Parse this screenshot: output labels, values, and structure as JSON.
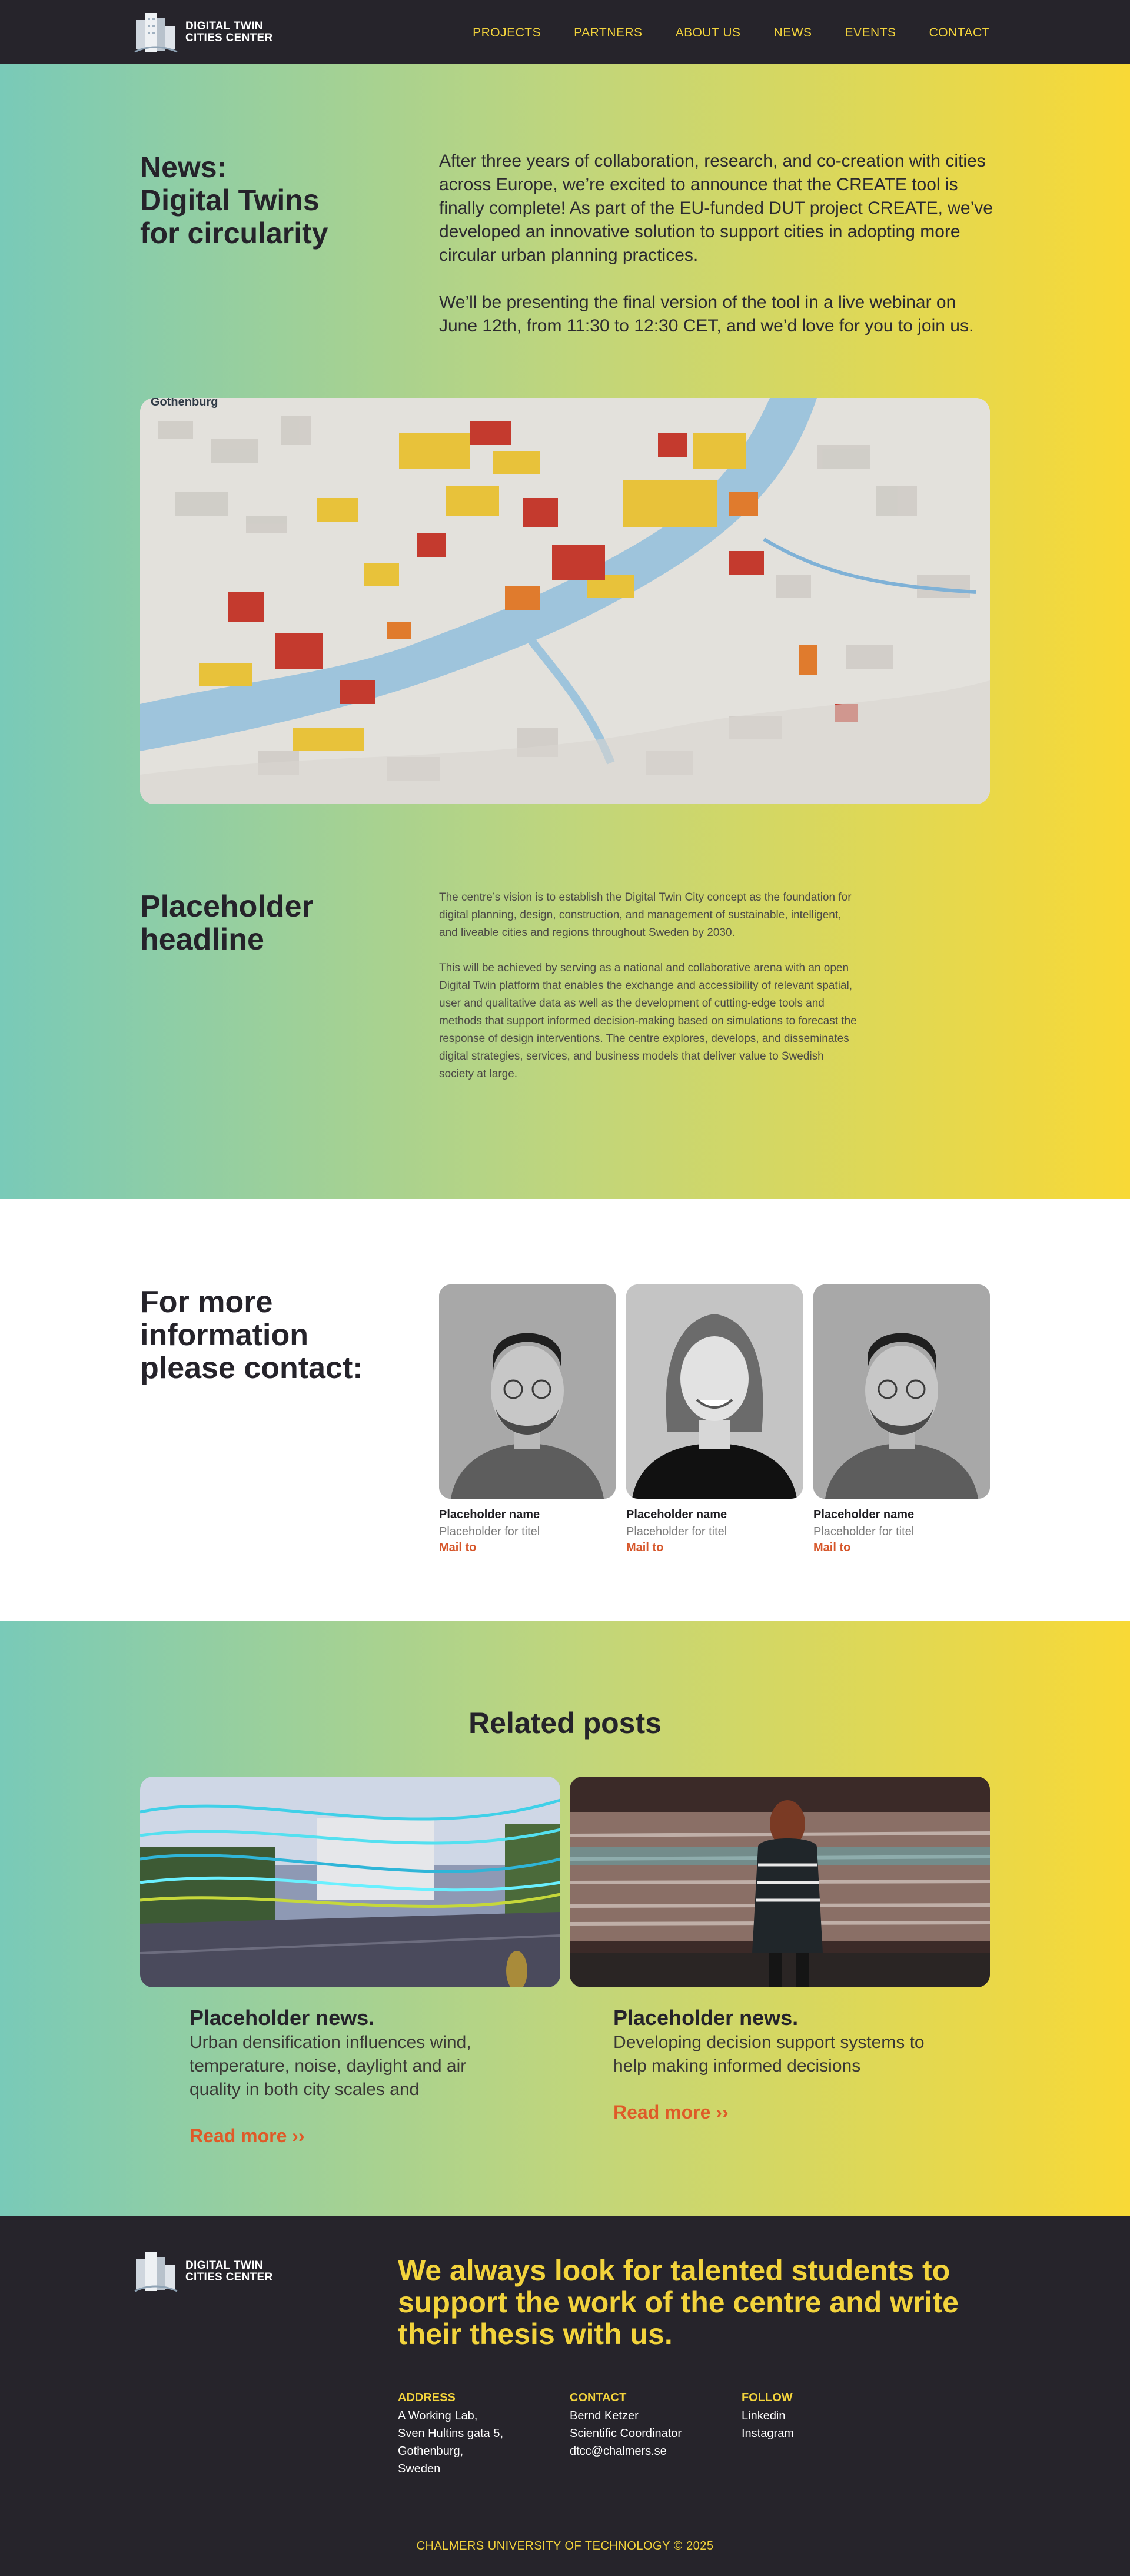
{
  "brand": {
    "name_line1": "DIGITAL TWIN",
    "name_line2": "CITIES CENTER"
  },
  "nav": {
    "items": [
      "PROJECTS",
      "PARTNERS",
      "ABOUT US",
      "NEWS",
      "EVENTS",
      "CONTACT"
    ]
  },
  "hero": {
    "title": "News:\nDigital Twins\nfor circularity",
    "paragraphs": [
      "After three years of collaboration, research, and co-creation with cities across Europe, we’re excited to announce that the CREATE tool is finally complete! As part of the EU-funded DUT project CREATE, we’ve developed an innovative solution to support cities in adopting more circular urban planning practices.",
      "We’ll be presenting the final version of the tool in a live webinar on June 12th, from 11:30 to 12:30 CET, and we’d love for you to join us."
    ],
    "image_label": "Gothenburg"
  },
  "placeholder": {
    "title": "Placeholder\nheadline",
    "paragraphs": [
      "The centre’s vision is to establish the Digital Twin City concept as the foundation for digital planning, design, construction, and management of sustainable, intelligent, and liveable cities and regions throughout Sweden by 2030.",
      "This will be achieved by serving as a national and collaborative arena with an open Digital Twin platform that enables the exchange and accessibility of relevant spatial, user and qualitative data as well as the development of cutting-edge tools and methods that support informed decision-making based on simulations to forecast the response of design interventions. The centre explores, develops, and disseminates digital strategies, services, and business models that deliver value to Swedish society at large."
    ]
  },
  "contact": {
    "title": "For more\ninformation\nplease contact:",
    "people": [
      {
        "name": "Placeholder name",
        "title": "Placeholder for titel",
        "mail": "Mail to"
      },
      {
        "name": "Placeholder name",
        "title": "Placeholder for titel",
        "mail": "Mail to"
      },
      {
        "name": "Placeholder name",
        "title": "Placeholder for titel",
        "mail": "Mail to"
      }
    ]
  },
  "related": {
    "title": "Related posts",
    "posts": [
      {
        "title": "Placeholder news.",
        "desc": "Urban densification influences wind, temperature, noise, daylight and air quality in both city scales and",
        "link": "Read more ››"
      },
      {
        "title": "Placeholder news.",
        "desc": "Developing decision support systems to help making informed decisions",
        "link": "Read more ››"
      }
    ]
  },
  "footer": {
    "headline": "We always look for talented students to support the work of the centre and write their thesis with us.",
    "address": {
      "label": "ADDRESS",
      "lines": [
        "A Working Lab,",
        "Sven Hultins gata 5,",
        "Gothenburg,",
        "Sweden"
      ]
    },
    "contact": {
      "label": "CONTACT",
      "lines": [
        "Bernd Ketzer",
        "Scientific Coordinator",
        "dtcc@chalmers.se"
      ]
    },
    "follow": {
      "label": "FOLLOW",
      "links": [
        "Linkedin",
        "Instagram"
      ]
    },
    "copyright": "CHALMERS UNIVERSITY OF TECHNOLOGY © 2025"
  },
  "colors": {
    "accent_yellow": "#f2d33c",
    "accent_orange": "#df5a28",
    "dark": "#26242b",
    "gradient_start": "#79cab8",
    "gradient_end": "#f8d936"
  }
}
